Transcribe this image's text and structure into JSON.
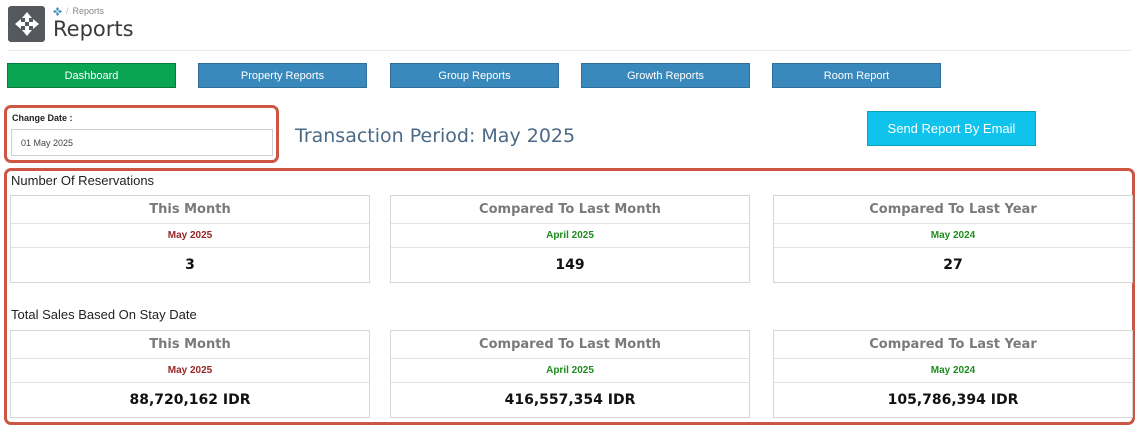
{
  "header": {
    "breadcrumb": "Reports",
    "title": "Reports",
    "app_icon": "move-arrows-icon"
  },
  "nav": {
    "dashboard": "Dashboard",
    "property_reports": "Property Reports",
    "group_reports": "Group Reports",
    "growth_reports": "Growth Reports",
    "room_report": "Room Report"
  },
  "filter": {
    "label": "Change Date :",
    "value": "01 May 2025"
  },
  "period_title": "Transaction Period: May 2025",
  "email_button": "Send Report By Email",
  "reservations": {
    "title": "Number Of Reservations",
    "cards": [
      {
        "heading": "This Month",
        "period": "May 2025",
        "value": "3"
      },
      {
        "heading": "Compared To Last Month",
        "period": "April 2025",
        "value": "149"
      },
      {
        "heading": "Compared To Last Year",
        "period": "May 2024",
        "value": "27"
      }
    ]
  },
  "sales": {
    "title": "Total Sales Based On Stay Date",
    "cards": [
      {
        "heading": "This Month",
        "period": "May 2025",
        "value": "88,720,162 IDR"
      },
      {
        "heading": "Compared To Last Month",
        "period": "April 2025",
        "value": "416,557,354 IDR"
      },
      {
        "heading": "Compared To Last Year",
        "period": "May 2024",
        "value": "105,786,394 IDR"
      }
    ]
  },
  "colors": {
    "active_nav": "#0aa553",
    "nav": "#3a89bd",
    "email_button": "#10c3ec",
    "highlight_border": "#cc5544",
    "current_period": "#962626",
    "comparison_period": "#1e8c1e"
  }
}
